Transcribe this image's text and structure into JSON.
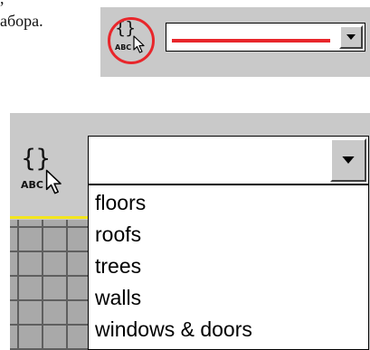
{
  "caption": {
    "line1": ",",
    "line2": "абора."
  },
  "selector_top": {
    "icon_text": "{}",
    "icon_label": "ABC",
    "selected_value": "",
    "highlight_color": "#e8262b"
  },
  "selector_bottom": {
    "icon_text": "{}",
    "icon_label": "ABC",
    "selected_value": "",
    "options": [
      "floors",
      "roofs",
      "trees",
      "walls",
      "windows & doors"
    ]
  },
  "colors": {
    "panel": "#c9c9c9",
    "highlight": "#e8262b",
    "layer_line": "#f3e51c"
  },
  "icons": {
    "selector": "braces-abc-cursor-icon",
    "dropdown": "dropdown-arrow-icon",
    "pointer": "cursor-arrow-icon"
  }
}
